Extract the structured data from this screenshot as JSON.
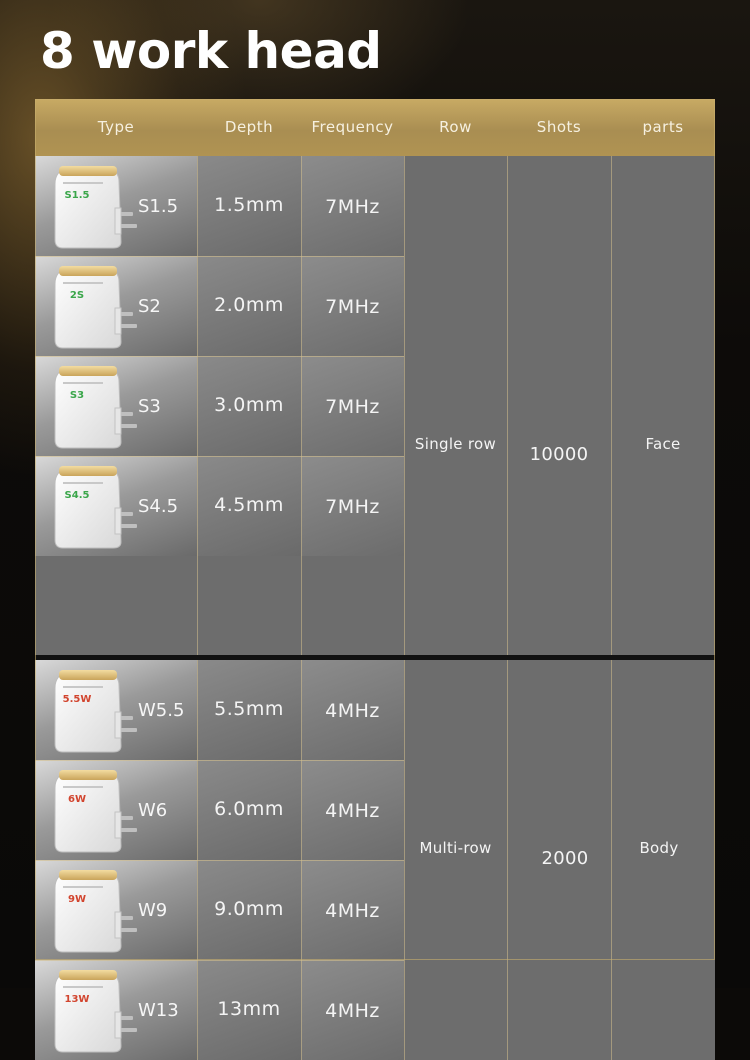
{
  "title": "8 work head",
  "headers": {
    "type": "Type",
    "depth": "Depth",
    "frequency": "Frequency",
    "row": "Row",
    "shots": "Shots",
    "parts": "parts"
  },
  "group1": {
    "row_type": "Single row",
    "shots": "10000",
    "parts": "Face",
    "rows": [
      {
        "type": "S1.5",
        "depth": "1.5mm",
        "frequency": "7MHz",
        "logo": "S1.5",
        "logo_color": "#3aa64a"
      },
      {
        "type": "S2",
        "depth": "2.0mm",
        "frequency": "7MHz",
        "logo": "2S",
        "logo_color": "#3aa64a"
      },
      {
        "type": "S3",
        "depth": "3.0mm",
        "frequency": "7MHz",
        "logo": "S3",
        "logo_color": "#3aa64a"
      },
      {
        "type": "S4.5",
        "depth": "4.5mm",
        "frequency": "7MHz",
        "logo": "S4.5",
        "logo_color": "#3aa64a"
      }
    ]
  },
  "group2": {
    "row_type": "Multi-row",
    "shots": "2000",
    "parts": "Body",
    "rows": [
      {
        "type": "W5.5",
        "depth": "5.5mm",
        "frequency": "4MHz",
        "logo": "5.5W",
        "logo_color": "#d2452f"
      },
      {
        "type": "W6",
        "depth": "6.0mm",
        "frequency": "4MHz",
        "logo": "6W",
        "logo_color": "#d2452f"
      },
      {
        "type": "W9",
        "depth": "9.0mm",
        "frequency": "4MHz",
        "logo": "9W",
        "logo_color": "#d2452f"
      },
      {
        "type": "W13",
        "depth": "13mm",
        "frequency": "4MHz",
        "logo": "13W",
        "logo_color": "#d2452f"
      }
    ]
  },
  "colors": {
    "header_gold": "#b59a58",
    "cell_gray": "#6d6d6d",
    "background": "#0c0a08"
  }
}
